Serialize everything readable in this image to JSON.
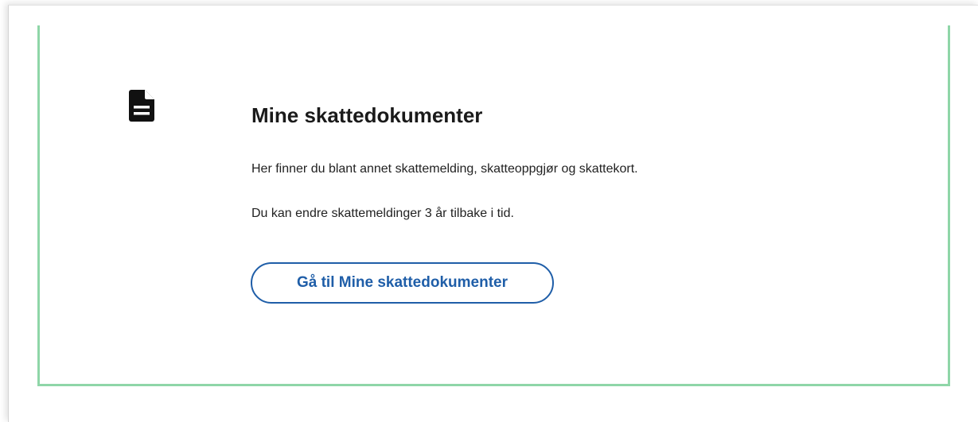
{
  "card": {
    "icon": "document-icon",
    "title": "Mine skattedokumenter",
    "description_1": "Her finner du blant annet skattemelding, skatteoppgjør og skattekort.",
    "description_2": "Du kan endre skattemeldinger 3 år tilbake i tid.",
    "button_label": "Gå til Mine skattedokumenter"
  },
  "colors": {
    "accent_border": "#8fd6a8",
    "button_blue": "#1f5ea8",
    "text": "#1a1a1a"
  }
}
